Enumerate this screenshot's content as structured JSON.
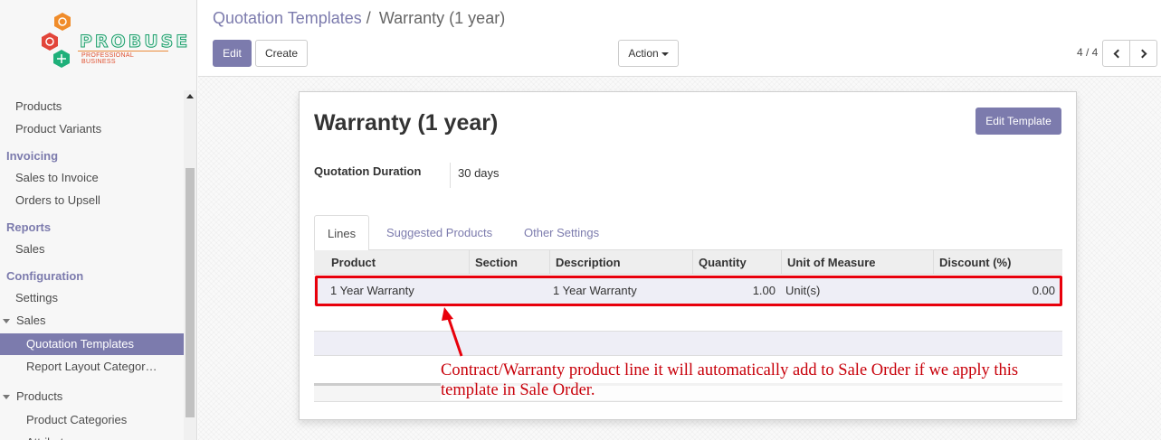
{
  "logo": {
    "brand": "PROBUSE",
    "tagline": "PROFESSIONAL BUSINESS"
  },
  "sidebar": {
    "items": [
      {
        "label": "Products",
        "kind": "item"
      },
      {
        "label": "Product Variants",
        "kind": "item"
      },
      {
        "label": "Invoicing",
        "kind": "header"
      },
      {
        "label": "Sales to Invoice",
        "kind": "item"
      },
      {
        "label": "Orders to Upsell",
        "kind": "item"
      },
      {
        "label": "Reports",
        "kind": "header"
      },
      {
        "label": "Sales",
        "kind": "item"
      },
      {
        "label": "Configuration",
        "kind": "header"
      },
      {
        "label": "Settings",
        "kind": "item"
      },
      {
        "label": "Sales",
        "kind": "group"
      },
      {
        "label": "Quotation Templates",
        "kind": "subitem",
        "active": true
      },
      {
        "label": "Report Layout Categor…",
        "kind": "subitem"
      },
      {
        "label": "Products",
        "kind": "group"
      },
      {
        "label": "Product Categories",
        "kind": "subitem"
      },
      {
        "label": "Attributes",
        "kind": "subitem"
      }
    ]
  },
  "breadcrumb": {
    "parent": "Quotation Templates",
    "separator": "/",
    "current": "Warranty (1 year)"
  },
  "toolbar": {
    "edit_label": "Edit",
    "create_label": "Create",
    "action_label": "Action"
  },
  "pager": {
    "value": "4 / 4"
  },
  "form": {
    "title": "Warranty (1 year)",
    "edit_template_label": "Edit Template",
    "duration_label": "Quotation Duration",
    "duration_value": "30 days",
    "tabs": [
      "Lines",
      "Suggested Products",
      "Other Settings"
    ],
    "active_tab": "Lines"
  },
  "lines_table": {
    "columns": [
      "Product",
      "Section",
      "Description",
      "Quantity",
      "Unit of Measure",
      "Discount (%)"
    ],
    "rows": [
      {
        "product": "1 Year Warranty",
        "section": "",
        "description": "1 Year Warranty",
        "quantity": "1.00",
        "uom": "Unit(s)",
        "discount": "0.00"
      }
    ]
  },
  "annotation": {
    "text": "Contract/Warranty product line it will automatically add to Sale Order if we apply this template in Sale Order."
  },
  "colors": {
    "brand": "#7c7bad",
    "annotation_red": "#e8000b"
  }
}
